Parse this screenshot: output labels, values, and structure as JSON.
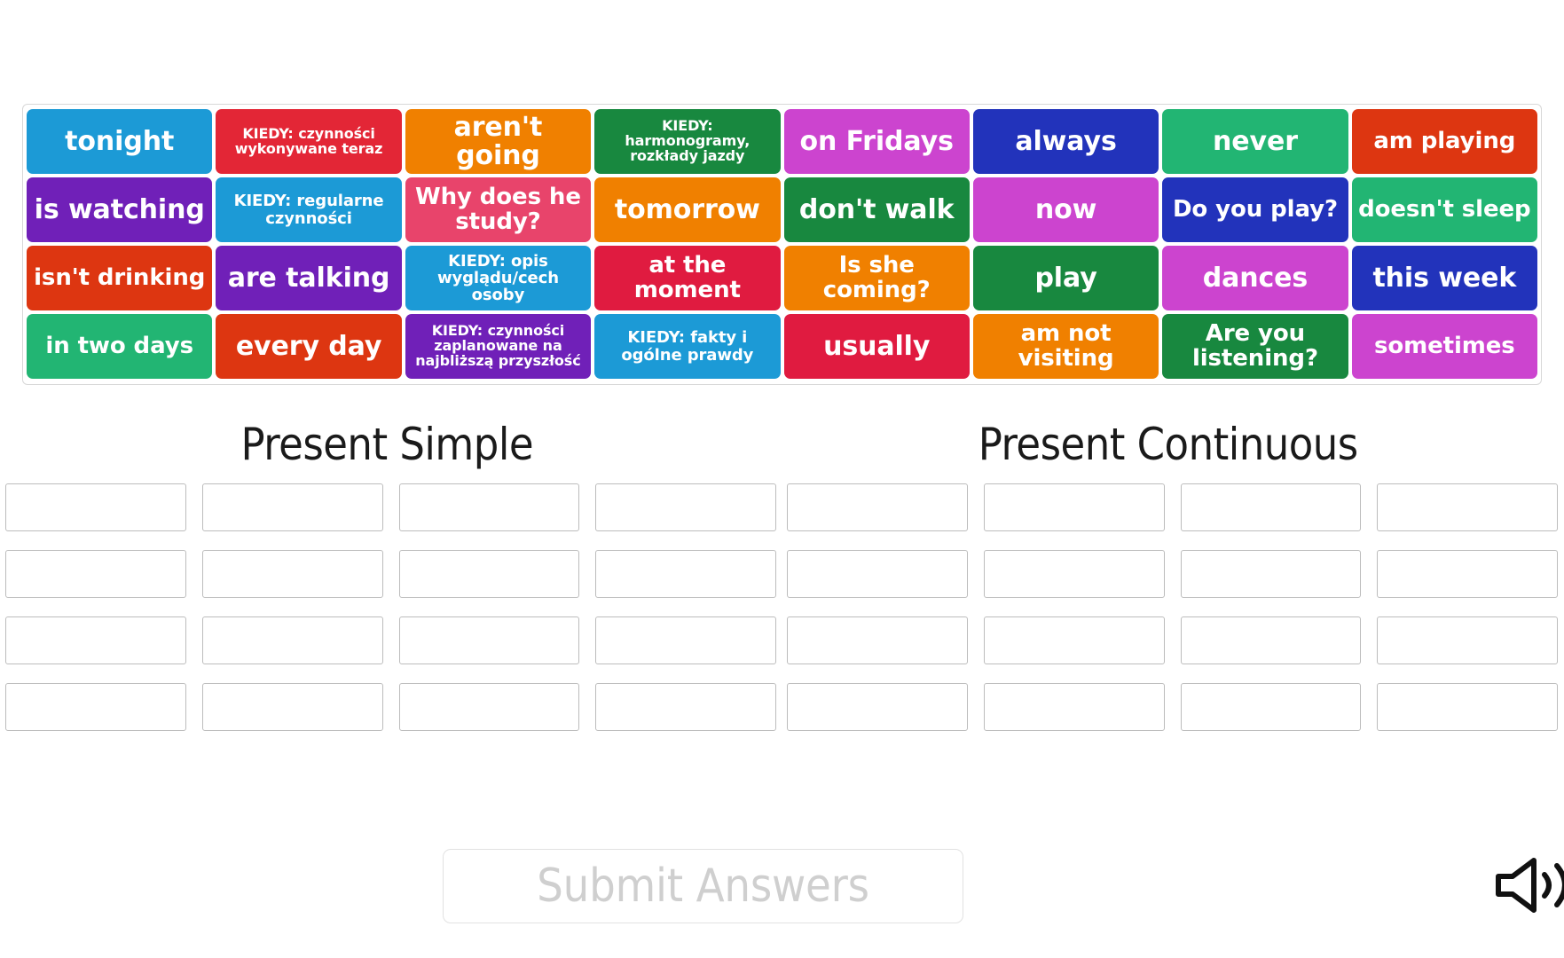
{
  "word_bank": {
    "rows": [
      [
        {
          "label": "tonight",
          "color": "#1c9ad6",
          "size": "big"
        },
        {
          "label": "KIEDY: czynności wykonywane teraz",
          "color": "#e32636",
          "size": "tiny"
        },
        {
          "label": "aren't going",
          "color": "#f08000",
          "size": "big"
        },
        {
          "label": "KIEDY: harmonogramy, rozkłady jazdy",
          "color": "#18883f",
          "size": "tiny"
        },
        {
          "label": "on Fridays",
          "color": "#cc44cf",
          "size": "big"
        },
        {
          "label": "always",
          "color": "#2233bb",
          "size": "big"
        },
        {
          "label": "never",
          "color": "#22b573",
          "size": "big"
        },
        {
          "label": "am playing",
          "color": "#dd3611",
          "size": "med"
        }
      ],
      [
        {
          "label": "is watching",
          "color": "#7020b8",
          "size": "big"
        },
        {
          "label": "KIEDY: regularne czynności",
          "color": "#1c9ad6",
          "size": "small"
        },
        {
          "label": "Why does he study?",
          "color": "#e8446b",
          "size": "med"
        },
        {
          "label": "tomorrow",
          "color": "#f08000",
          "size": "big"
        },
        {
          "label": "don't walk",
          "color": "#18883f",
          "size": "big"
        },
        {
          "label": "now",
          "color": "#cc44cf",
          "size": "big"
        },
        {
          "label": "Do you play?",
          "color": "#2233bb",
          "size": "med"
        },
        {
          "label": "doesn't sleep",
          "color": "#22b573",
          "size": "med"
        }
      ],
      [
        {
          "label": "isn't drinking",
          "color": "#dd3611",
          "size": "med"
        },
        {
          "label": "are talking",
          "color": "#7020b8",
          "size": "big"
        },
        {
          "label": "KIEDY: opis wyglądu/cech osoby",
          "color": "#1c9ad6",
          "size": "small"
        },
        {
          "label": "at the moment",
          "color": "#e01b40",
          "size": "med"
        },
        {
          "label": "Is she coming?",
          "color": "#f08000",
          "size": "med"
        },
        {
          "label": "play",
          "color": "#18883f",
          "size": "big"
        },
        {
          "label": "dances",
          "color": "#cc44cf",
          "size": "big"
        },
        {
          "label": "this week",
          "color": "#2233bb",
          "size": "big"
        }
      ],
      [
        {
          "label": "in two days",
          "color": "#22b573",
          "size": "med"
        },
        {
          "label": "every day",
          "color": "#dd3611",
          "size": "big"
        },
        {
          "label": "KIEDY: czynności zaplanowane na najbliższą przyszłość",
          "color": "#7020b8",
          "size": "tiny"
        },
        {
          "label": "KIEDY: fakty i ogólne prawdy",
          "color": "#1c9ad6",
          "size": "small"
        },
        {
          "label": "usually",
          "color": "#e01b40",
          "size": "big"
        },
        {
          "label": "am not visiting",
          "color": "#f08000",
          "size": "med"
        },
        {
          "label": "Are you listening?",
          "color": "#18883f",
          "size": "med"
        },
        {
          "label": "sometimes",
          "color": "#cc44cf",
          "size": "med"
        }
      ]
    ]
  },
  "categories": [
    {
      "title": "Present Simple",
      "slot_rows": 4,
      "slots_per_row": 4
    },
    {
      "title": "Present Continuous",
      "slot_rows": 4,
      "slots_per_row": 4
    }
  ],
  "submit": {
    "label": "Submit Answers"
  },
  "icons": {
    "sound": "speaker-icon"
  }
}
